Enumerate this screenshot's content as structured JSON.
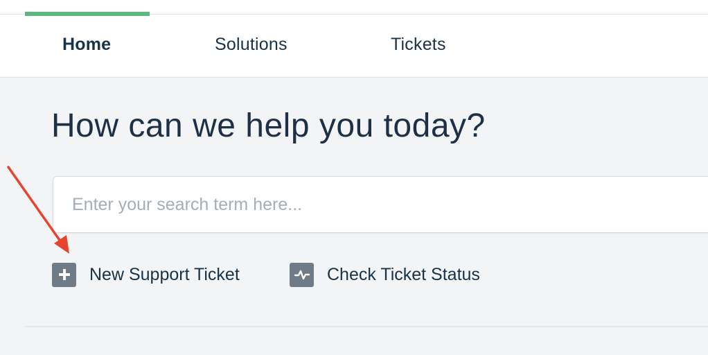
{
  "nav": {
    "tabs": [
      {
        "label": "Home",
        "active": true
      },
      {
        "label": "Solutions",
        "active": false
      },
      {
        "label": "Tickets",
        "active": false
      }
    ],
    "indicator_color": "#59b97c"
  },
  "hero": {
    "title": "How can we help you today?"
  },
  "search": {
    "placeholder": "Enter your search term here...",
    "value": ""
  },
  "actions": [
    {
      "label": "New Support Ticket",
      "icon": "plus-icon"
    },
    {
      "label": "Check Ticket Status",
      "icon": "activity-icon"
    }
  ],
  "annotation": {
    "arrow_color": "#e8432e",
    "points_to": "New Support Ticket"
  }
}
